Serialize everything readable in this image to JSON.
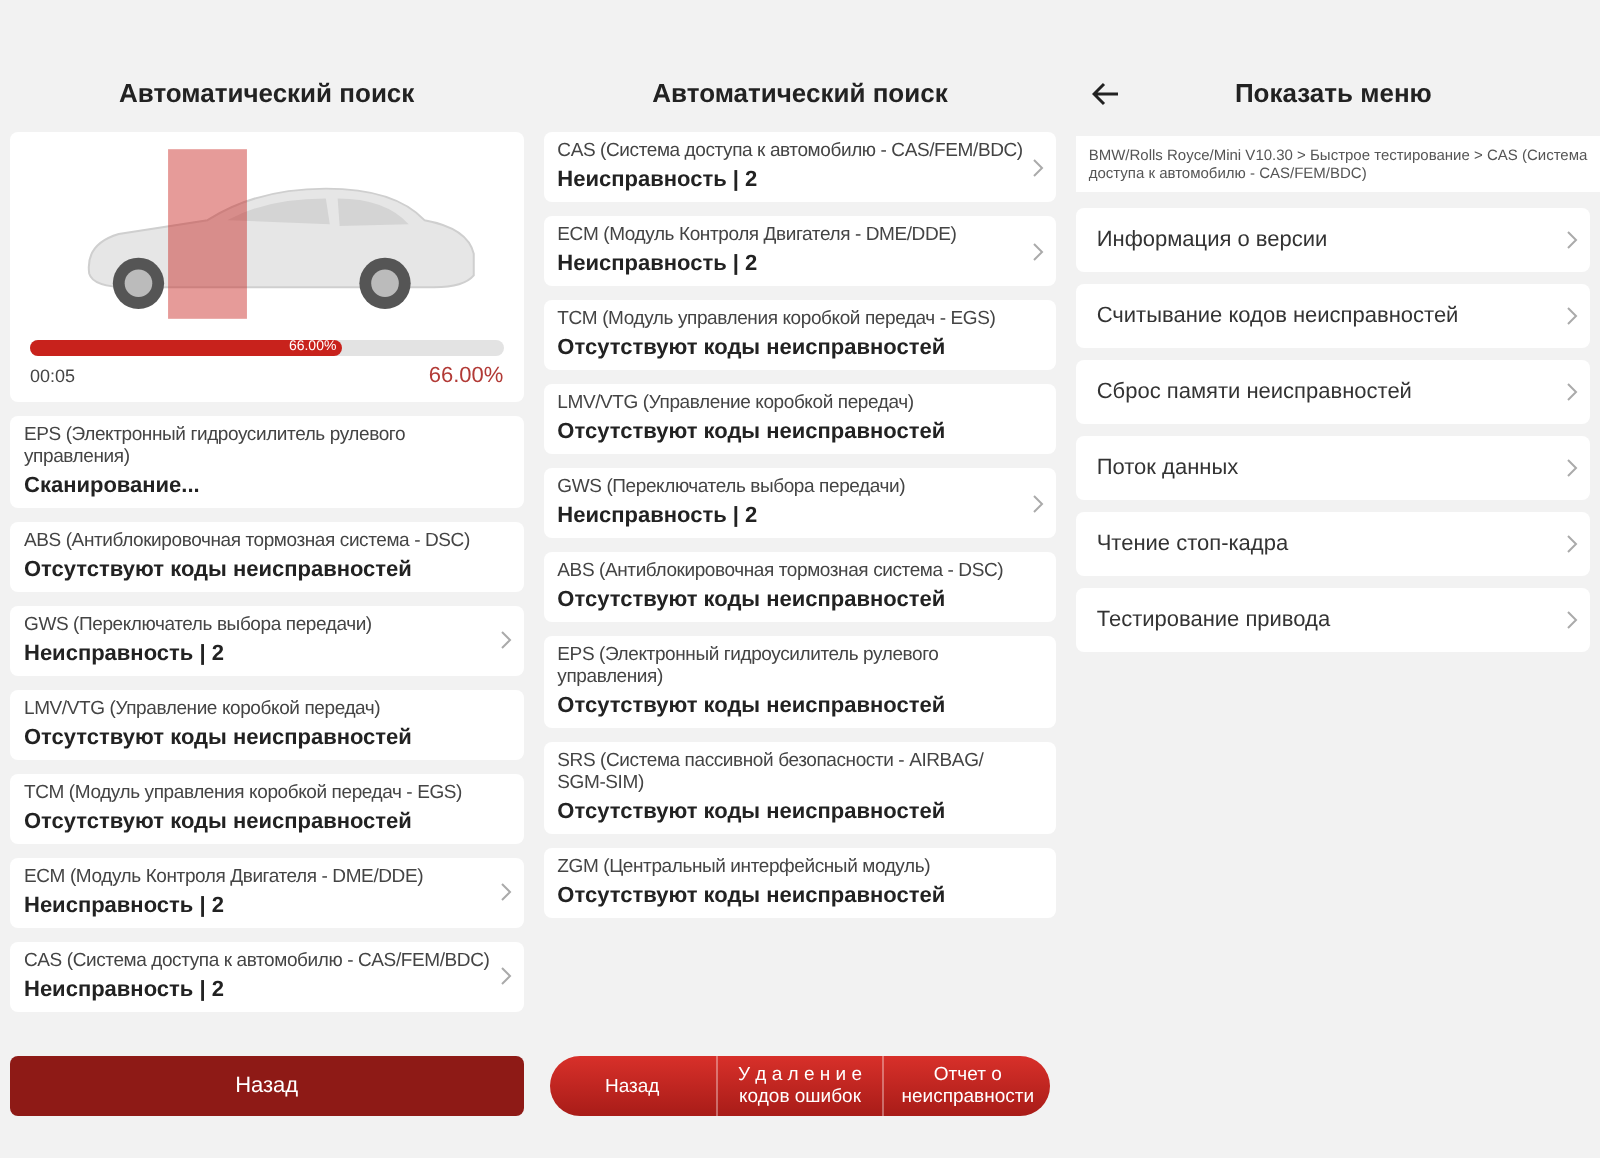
{
  "scan_panel": {
    "title": "Автоматический поиск",
    "progress": {
      "level": 0.66,
      "bar_label": "66.00%",
      "elapsed": "00:05",
      "percent": "66.00%"
    },
    "modules": [
      {
        "name": "EPS (Электронный гидроусилитель рулевого управления)",
        "status": "Сканирование...",
        "chevron": false
      },
      {
        "name": "ABS (Антиблокировочная тормозная система - DSC)",
        "status": "Отсутствуют коды неисправностей",
        "chevron": false
      },
      {
        "name": "GWS (Переключатель выбора передачи)",
        "status": "Неисправность | 2",
        "chevron": true
      },
      {
        "name": "LMV/VTG (Управление коробкой передач)",
        "status": "Отсутствуют коды неисправностей",
        "chevron": false
      },
      {
        "name": "TCM (Модуль управления коробкой передач - EGS)",
        "status": "Отсутствуют коды неисправностей",
        "chevron": false
      },
      {
        "name": "ECM (Модуль Контроля Двигателя - DME/DDE)",
        "status": "Неисправность | 2",
        "chevron": true
      },
      {
        "name": "CAS (Система доступа к автомобилю - CAS/FEM/BDC)",
        "status": "Неисправность | 2",
        "chevron": true
      }
    ],
    "buttons": [
      "Назад"
    ]
  },
  "results_panel": {
    "title": "Автоматический поиск",
    "modules": [
      {
        "name": "CAS (Система доступа к автомобилю - CAS/FEM/BDC)",
        "status": "Неисправность | 2",
        "chevron": true
      },
      {
        "name": "ECM (Модуль Контроля Двигателя - DME/DDE)",
        "status": "Неисправность | 2",
        "chevron": true
      },
      {
        "name": "TCM (Модуль управления коробкой передач - EGS)",
        "status": "Отсутствуют коды неисправностей",
        "chevron": false
      },
      {
        "name": "LMV/VTG (Управление коробкой передач)",
        "status": "Отсутствуют коды неисправностей",
        "chevron": false
      },
      {
        "name": "GWS (Переключатель выбора передачи)",
        "status": "Неисправность | 2",
        "chevron": true
      },
      {
        "name": "ABS (Антиблокировочная тормозная система - DSC)",
        "status": "Отсутствуют коды неисправностей",
        "chevron": false
      },
      {
        "name": "EPS (Электронный гидроусилитель рулевого управления)",
        "status": "Отсутствуют коды неисправностей",
        "chevron": false
      },
      {
        "name": "SRS (Система пассивной безопасности - AIRBAG/ SGM-SIM)",
        "status": "Отсутствуют коды неисправностей",
        "chevron": false
      },
      {
        "name": "ZGM (Центральный интерфейсный модуль)",
        "status": "Отсутствуют коды неисправностей",
        "chevron": false
      }
    ],
    "buttons": [
      "Назад",
      "У д а л е н и е кодов ошибок",
      "Отчет о неисправности"
    ]
  },
  "menu_panel": {
    "title": "Показать меню",
    "breadcrumb": "BMW/Rolls Royce/Mini V10.30 > Быстрое тестирование  > CAS (Система доступа к автомобилю - CAS/FEM/BDC)",
    "items": [
      {
        "label": "Информация о версии",
        "chevron": true
      },
      {
        "label": "Считывание кодов неисправностей",
        "chevron": true
      },
      {
        "label": "Сброс памяти неисправностей",
        "chevron": true
      },
      {
        "label": "Поток данных",
        "chevron": true
      },
      {
        "label": "Чтение стоп-кадра",
        "chevron": true
      },
      {
        "label": "Тестирование привода",
        "chevron": true
      }
    ]
  }
}
